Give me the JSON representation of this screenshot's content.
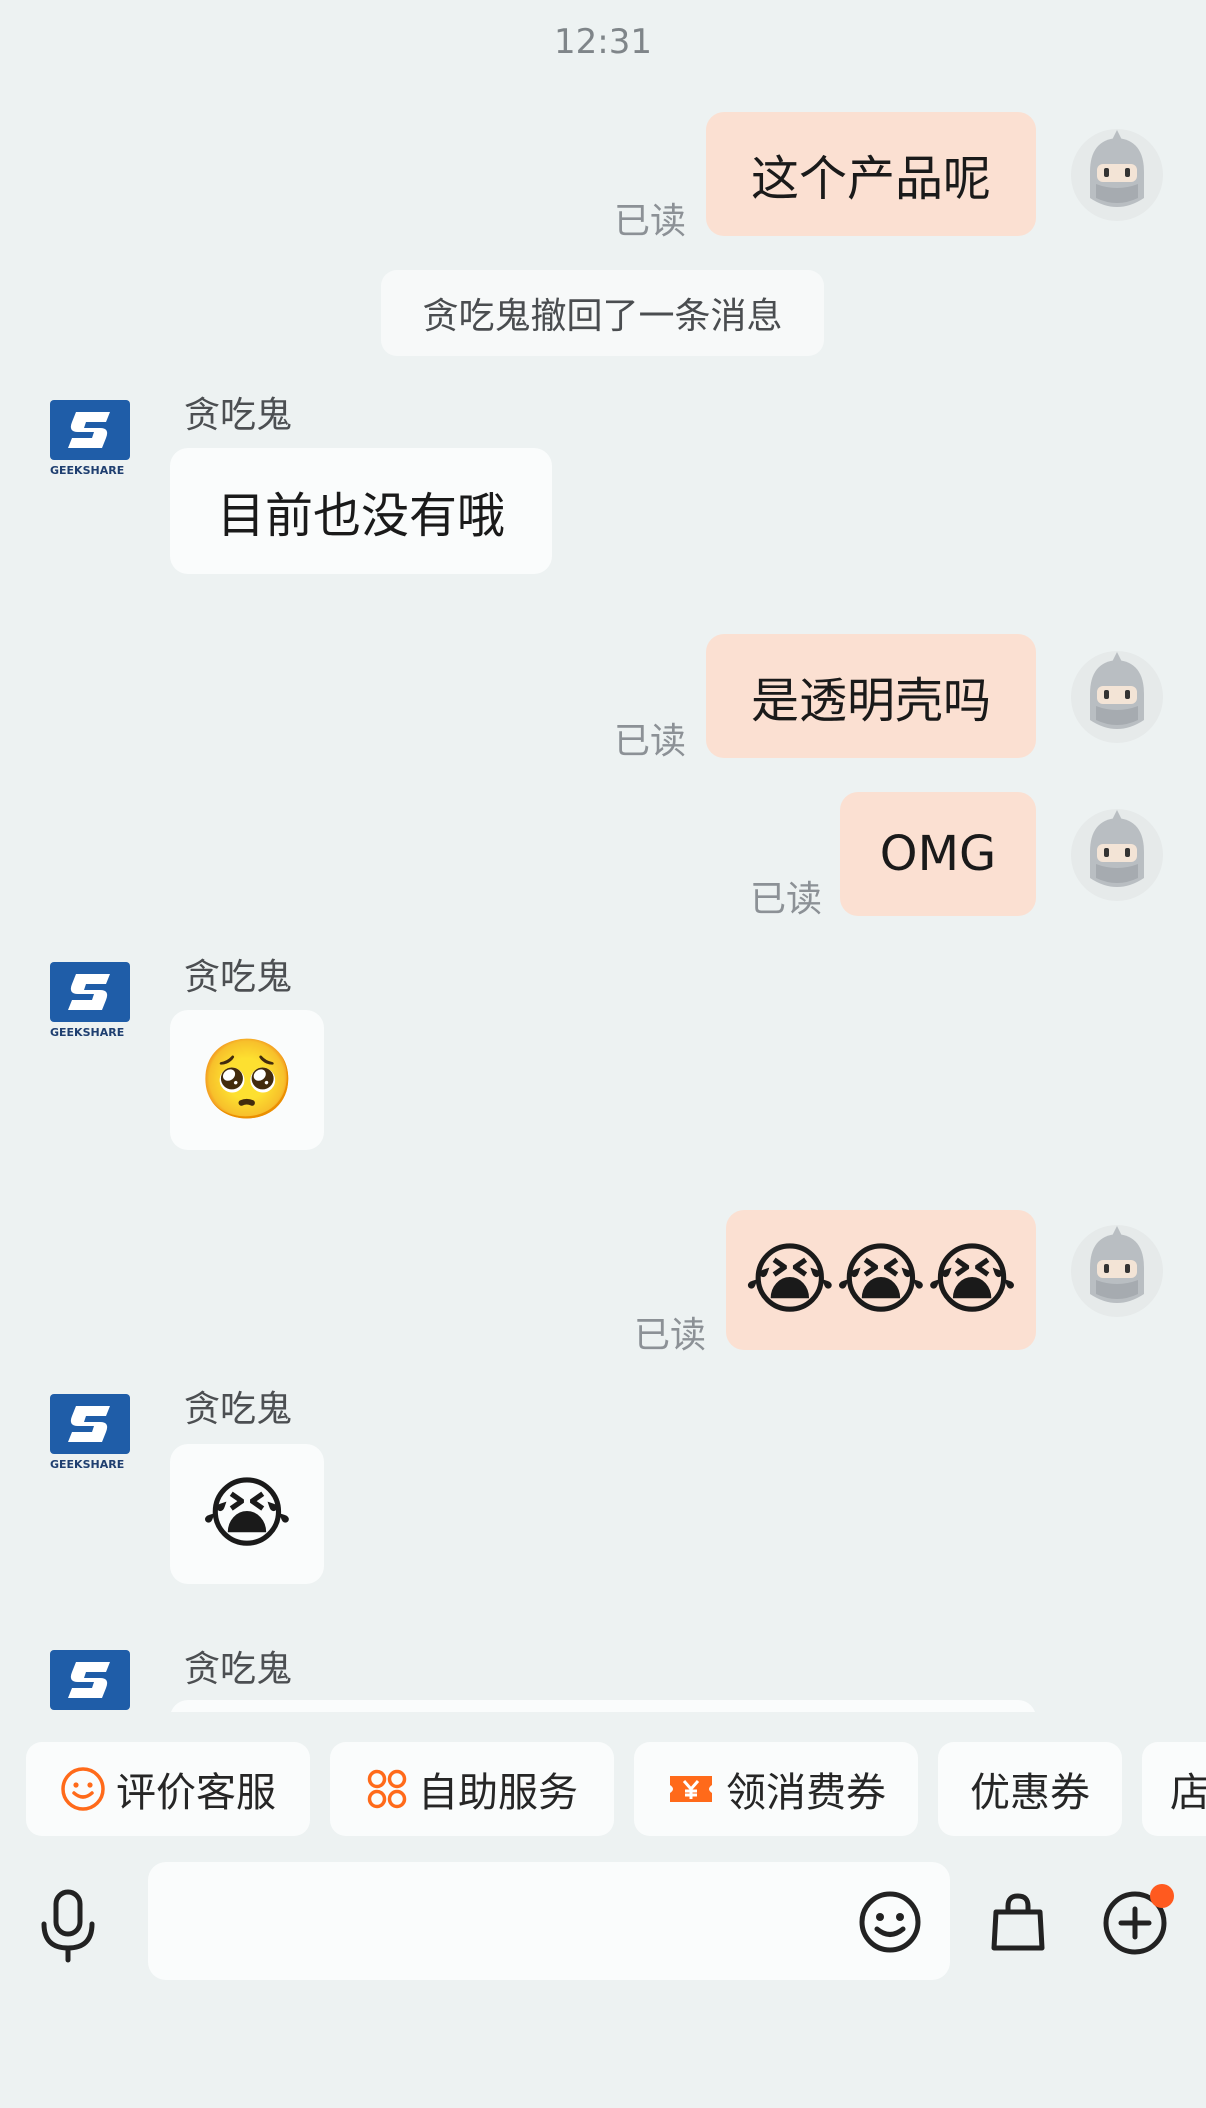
{
  "timestamp": "12:31",
  "system_note": "贪吃鬼撤回了一条消息",
  "read_label": "已读",
  "shop_name": "贪吃鬼",
  "shop_logo_text": "GEEKSHARE",
  "messages": {
    "out_1": "这个产品呢",
    "in_1": "目前也没有哦",
    "out_2": "是透明壳吗",
    "out_3": "OMG",
    "in_2": "🥺",
    "out_4": "😭😭😭",
    "in_3": "😭"
  },
  "quick_actions": [
    "评价客服",
    "自助服务",
    "领消费券",
    "优惠券",
    "店"
  ],
  "input": {
    "placeholder": ""
  },
  "colors": {
    "background": "#edf2f2",
    "outgoing_bubble": "#fbe0d2",
    "incoming_bubble": "#fafcfc",
    "accent": "#ff6a1a",
    "logo_blue": "#1f5da8"
  },
  "icons": [
    "microphone-icon",
    "smiley-icon",
    "shopping-bag-icon",
    "plus-circle-icon",
    "notification-dot"
  ]
}
